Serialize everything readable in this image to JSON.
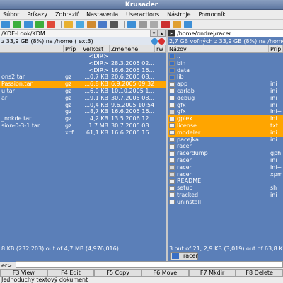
{
  "window": {
    "title": "Krusader"
  },
  "menu": [
    "Súbor",
    "Príkazy",
    "Zobraziť",
    "Nastavenia",
    "Useractions",
    "Nástroje",
    "Pomocník"
  ],
  "toolbar": {
    "buttons": [
      {
        "name": "back-icon",
        "color": "#3d8fd6"
      },
      {
        "name": "refresh-icon",
        "color": "#3cae3c"
      },
      {
        "name": "home-icon",
        "color": "#3d8fd6"
      },
      {
        "name": "select-icon",
        "color": "#3cae3c"
      },
      {
        "name": "unselect-icon",
        "color": "#e04a3a"
      },
      {
        "name": "compare-icon",
        "color": "#e8b030"
      },
      {
        "name": "search-icon",
        "color": "#4aa8e0"
      },
      {
        "name": "sync-icon",
        "color": "#d08a30"
      },
      {
        "name": "network-icon",
        "color": "#4a7ac8"
      },
      {
        "name": "terminal-icon",
        "color": "#555555"
      },
      {
        "name": "swap-icon",
        "color": "#3d8fd6"
      },
      {
        "name": "tools-icon",
        "color": "#999999"
      },
      {
        "name": "mount-icon",
        "color": "#aaaaaa"
      },
      {
        "name": "flag-icon",
        "color": "#cc3030"
      },
      {
        "name": "home-right-icon",
        "color": "#e0a030"
      },
      {
        "name": "root-icon",
        "color": "#3d8fd6"
      }
    ]
  },
  "left_panel": {
    "path": "/KDE-Look/KDM",
    "free_space": "z 33,9 GB (8%) na /home ( ext3)",
    "columns": [
      "",
      "Príp",
      "Veľkosť",
      "Zmenené",
      "rw"
    ],
    "rows": [
      {
        "name": "",
        "ext": "",
        "size": "<DIR>",
        "date": "",
        "style": "dark"
      },
      {
        "name": "",
        "ext": "",
        "size": "<DIR>",
        "date": "28.3.2005 02...",
        "style": "dark"
      },
      {
        "name": "",
        "ext": "",
        "size": "<DIR>",
        "date": "16.6.2005 16...",
        "style": "dark"
      },
      {
        "name": "ons2.tar",
        "ext": "gz",
        "size": "...0,7 KB",
        "date": "20.6.2005 08...",
        "style": "dark"
      },
      {
        "name": "Passion.tar",
        "ext": "gz",
        "size": "...6,8 KB",
        "date": "6.9.2005 09:32",
        "style": "sel"
      },
      {
        "name": "u.tar",
        "ext": "gz",
        "size": "...6,9 KB",
        "date": "10.10.2005 1...",
        "style": "dark"
      },
      {
        "name": "ar",
        "ext": "gz",
        "size": "...9,1 KB",
        "date": "30.7.2005 08...",
        "style": "dark"
      },
      {
        "name": "",
        "ext": "gz",
        "size": "...0,4 KB",
        "date": "9.6.2005 10:54",
        "style": "dark"
      },
      {
        "name": "",
        "ext": "gz",
        "size": "...8,7 KB",
        "date": "16.6.2005 16...",
        "style": "dark"
      },
      {
        "name": "_nokde.tar",
        "ext": "gz",
        "size": "...4,2 KB",
        "date": "13.5.2006 12...",
        "style": "dark"
      },
      {
        "name": "sion-0-3-1.tar",
        "ext": "gz",
        "size": "1,7 MB",
        "date": "30.7.2005 08...",
        "style": "dark"
      },
      {
        "name": "",
        "ext": "xcf",
        "size": "61,1 KB",
        "date": "16.6.2005 16...",
        "style": "dark"
      }
    ],
    "status": "8 KB (232,203) out of 4,7 MB (4,976,016)"
  },
  "right_panel": {
    "path": "/home/ondrej/racer",
    "free_space": "2,7 GB voľných z 33,9 GB (8%) na /home ( ext3)",
    "columns": [
      "Názov",
      "Príp"
    ],
    "rows": [
      {
        "name": "..",
        "ext": "",
        "icon": "folder",
        "style": "dark"
      },
      {
        "name": "bin",
        "ext": "",
        "icon": "folder",
        "style": "dark"
      },
      {
        "name": "data",
        "ext": "",
        "icon": "folder",
        "style": "dark"
      },
      {
        "name": "lib",
        "ext": "",
        "icon": "folder",
        "style": "dark"
      },
      {
        "name": "app",
        "ext": "ini",
        "icon": "file",
        "style": "dark"
      },
      {
        "name": "carlab",
        "ext": "ini",
        "icon": "file",
        "style": "dark"
      },
      {
        "name": "debug",
        "ext": "ini",
        "icon": "file",
        "style": "dark"
      },
      {
        "name": "gfx",
        "ext": "ini",
        "icon": "file",
        "style": "dark"
      },
      {
        "name": "gfx",
        "ext": "ini~",
        "icon": "script",
        "style": "dark"
      },
      {
        "name": "gplex",
        "ext": "ini",
        "icon": "file",
        "style": "sel"
      },
      {
        "name": "license",
        "ext": "txt",
        "icon": "file",
        "style": "sel"
      },
      {
        "name": "modeler",
        "ext": "ini",
        "icon": "file",
        "style": "sel"
      },
      {
        "name": "pacejka",
        "ext": "ini",
        "icon": "file",
        "style": "dark"
      },
      {
        "name": "racer",
        "ext": "",
        "icon": "file",
        "style": "dark"
      },
      {
        "name": "racerdump",
        "ext": "gph",
        "icon": "file",
        "style": "dark"
      },
      {
        "name": "racer",
        "ext": "ini",
        "icon": "file",
        "style": "dark"
      },
      {
        "name": "racer",
        "ext": "ini~",
        "icon": "script",
        "style": "dark"
      },
      {
        "name": "racer",
        "ext": "xpm",
        "icon": "script",
        "style": "dark"
      },
      {
        "name": "README",
        "ext": "",
        "icon": "file",
        "style": "dark"
      },
      {
        "name": "setup",
        "ext": "sh",
        "icon": "file",
        "style": "dark"
      },
      {
        "name": "tracked",
        "ext": "ini",
        "icon": "file",
        "style": "dark"
      },
      {
        "name": "uninstall",
        "ext": "",
        "icon": "file",
        "style": "dark"
      }
    ],
    "status": "3 out of 21, 2,9 KB (3,019) out of 63,8 KB"
  },
  "tab": {
    "label": "racer"
  },
  "cmdline": {
    "prompt": "er>"
  },
  "fkeys": [
    "F3 View",
    "F4 Edit",
    "F5 Copy",
    "F6 Move",
    "F7 Mkdir",
    "F8 Delete"
  ],
  "statusbar": "Jednoduchý textový dokument",
  "colors": {
    "panel_bg": "#5b7fb8",
    "selection": "#ffa500"
  }
}
